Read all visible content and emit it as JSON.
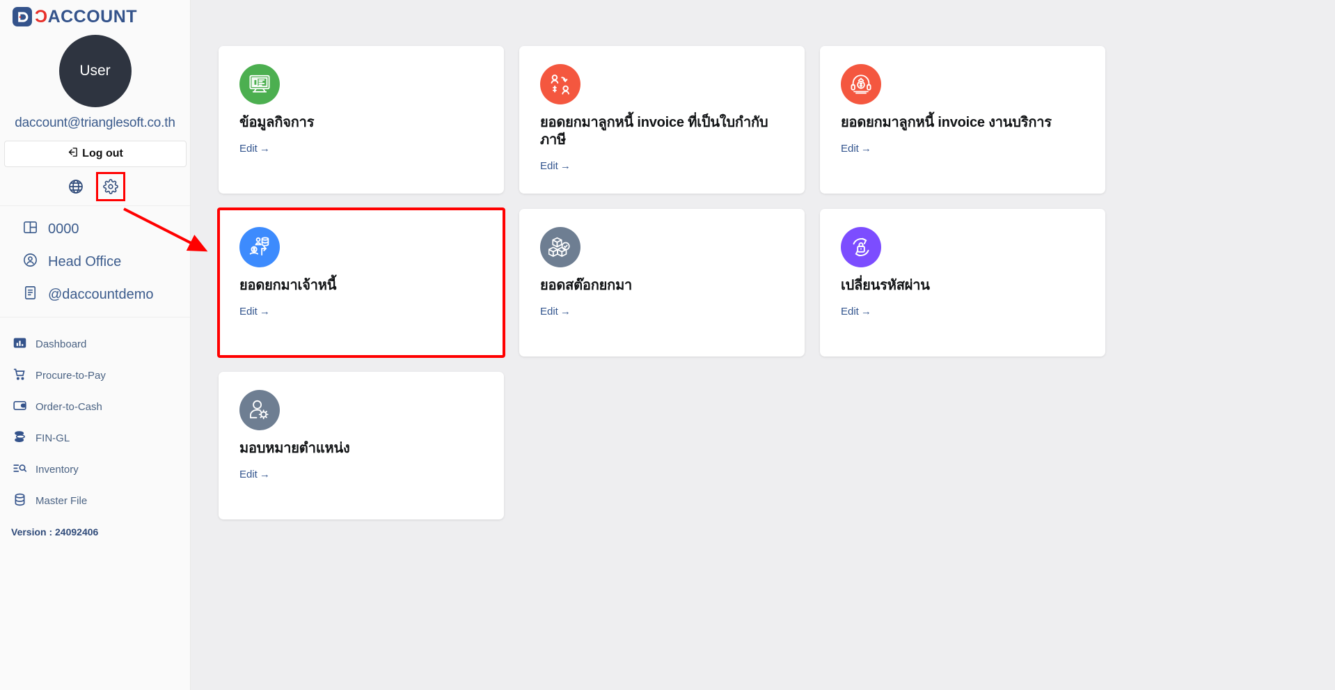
{
  "brand": {
    "logo_d": "Ɔ",
    "logo_prefix": "Ɔ",
    "name_colored": "Ɔ",
    "name": "ACCOUNT",
    "full": "DACCOUNT"
  },
  "sidebar": {
    "avatar_label": "User",
    "email": "daccount@trianglesoft.co.th",
    "logout_label": "Log out",
    "icon_buttons": [
      {
        "name": "language-globe-icon",
        "label": "globe"
      },
      {
        "name": "settings-gear-icon",
        "label": "gear",
        "highlighted": true
      }
    ],
    "context_items": [
      {
        "icon": "book-icon",
        "label": "0000"
      },
      {
        "icon": "user-circle-icon",
        "label": "Head Office"
      },
      {
        "icon": "document-icon",
        "label": "@daccountdemo"
      }
    ],
    "nav_items": [
      {
        "icon": "bar-chart-icon",
        "label": "Dashboard",
        "active": true
      },
      {
        "icon": "shopping-cart-icon",
        "label": "Procure-to-Pay",
        "active": false
      },
      {
        "icon": "wallet-icon",
        "label": "Order-to-Cash",
        "active": false
      },
      {
        "icon": "coins-stack-icon",
        "label": "FIN-GL",
        "active": false
      },
      {
        "icon": "list-search-icon",
        "label": "Inventory",
        "active": false
      },
      {
        "icon": "database-icon",
        "label": "Master File",
        "active": false
      }
    ],
    "version": "Version : 24092406"
  },
  "main": {
    "edit_label": "Edit",
    "edit_arrow": "→",
    "cards": [
      {
        "title": "ข้อมูลกิจการ",
        "icon": "monitor-business-info-icon",
        "color": "#4caf50",
        "highlighted": false
      },
      {
        "title": "ยอดยกมาลูกหนี้ invoice ที่เป็นใบกำกับภาษี",
        "icon": "accounts-receivable-transfer-icon",
        "color": "#f4573f",
        "highlighted": false
      },
      {
        "title": "ยอดยกมาลูกหนี้ invoice งานบริการ",
        "icon": "service-revenue-icon",
        "color": "#f4573f",
        "highlighted": false
      },
      {
        "title": "ยอดยกมาเจ้าหนี้",
        "icon": "accounts-payable-icon",
        "color": "#3d8bfd",
        "highlighted": true
      },
      {
        "title": "ยอดสต๊อกยกมา",
        "icon": "stock-boxes-icon",
        "color": "#6e7e92",
        "highlighted": false
      },
      {
        "title": "เปลี่ยนรหัสผ่าน",
        "icon": "change-password-lock-icon",
        "color": "#7c4dff",
        "highlighted": false
      },
      {
        "title": "มอบหมายตำแหน่ง",
        "icon": "assign-role-user-gear-icon",
        "color": "#6e7e92",
        "highlighted": false
      }
    ]
  },
  "annotation": {
    "type": "red-arrow",
    "color": "#ff0000",
    "from": "settings-gear-icon",
    "to": "card-accounts-payable"
  },
  "colors": {
    "sidebar_bg": "#fafafa",
    "main_bg": "#eeeef0",
    "brand_blue": "#34538b",
    "brand_red": "#e8302a",
    "link_blue": "#33558e",
    "annotation_red": "#ff0000"
  }
}
